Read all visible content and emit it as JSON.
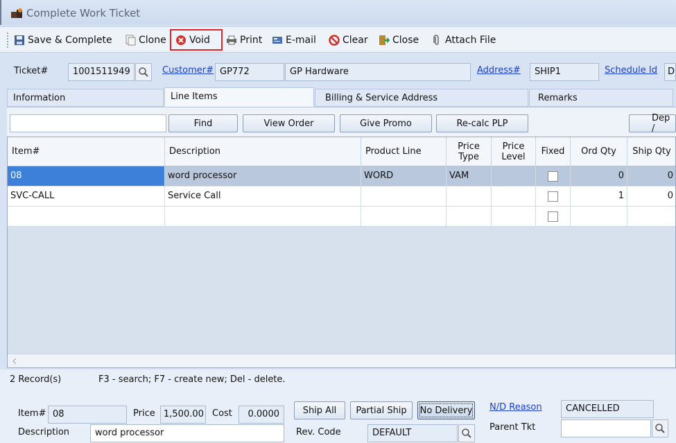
{
  "window": {
    "title": "Complete Work Ticket"
  },
  "toolbar": {
    "save_complete": "Save & Complete",
    "clone": "Clone",
    "void": "Void",
    "print": "Print",
    "email": "E-mail",
    "clear": "Clear",
    "close": "Close",
    "attach_file": "Attach File"
  },
  "header": {
    "ticket_label": "Ticket#",
    "ticket_value": "1001511949",
    "customer_label": "Customer#",
    "customer_id": "GP772",
    "customer_name": "GP Hardware",
    "address_label": "Address#",
    "address_value": "SHIP1",
    "schedule_label": "Schedule Id",
    "schedule_value": "D"
  },
  "tabs": [
    {
      "label": "Information"
    },
    {
      "label": "Line Items"
    },
    {
      "label": "Billing & Service Address"
    },
    {
      "label": "Remarks"
    }
  ],
  "actions": {
    "find": "Find",
    "view_order": "View Order",
    "give_promo": "Give Promo",
    "recalc_plp": "Re-calc PLP",
    "dep": "Dep /"
  },
  "grid": {
    "headers": [
      "Item#",
      "Description",
      "Product Line",
      "Price Type",
      "Price Level",
      "Fixed",
      "Ord Qty",
      "Ship Qty"
    ],
    "rows": [
      {
        "item": "08",
        "description": "word processor",
        "product_line": "WORD",
        "price_type": "VAM",
        "price_level": "",
        "ord_qty": "0",
        "ship_qty": "0"
      },
      {
        "item": "SVC-CALL",
        "description": "Service Call",
        "product_line": "",
        "price_type": "",
        "price_level": "",
        "ord_qty": "1",
        "ship_qty": "0"
      },
      {
        "item": "",
        "description": "",
        "product_line": "",
        "price_type": "",
        "price_level": "",
        "ord_qty": "",
        "ship_qty": ""
      }
    ]
  },
  "status": {
    "records": "2 Record(s)",
    "hint": "F3 - search; F7 - create new; Del - delete."
  },
  "detail": {
    "item_label": "Item#",
    "item_value": "08",
    "price_label": "Price",
    "price_value": "1,500.00",
    "cost_label": "Cost",
    "cost_value": "0.0000",
    "ship_all": "Ship All",
    "partial_ship": "Partial Ship",
    "no_delivery": "No Delivery",
    "nd_reason_label": "N/D Reason",
    "nd_reason_value": "CANCELLED",
    "description_label": "Description",
    "description_value": "word processor",
    "rev_code_label": "Rev. Code",
    "rev_code_value": "DEFAULT",
    "parent_tkt_label": "Parent Tkt",
    "parent_tkt_value": ""
  },
  "colors": {
    "accent": "#3d80d9",
    "highlight_border": "#e0262a",
    "link": "#1a3fd0"
  }
}
